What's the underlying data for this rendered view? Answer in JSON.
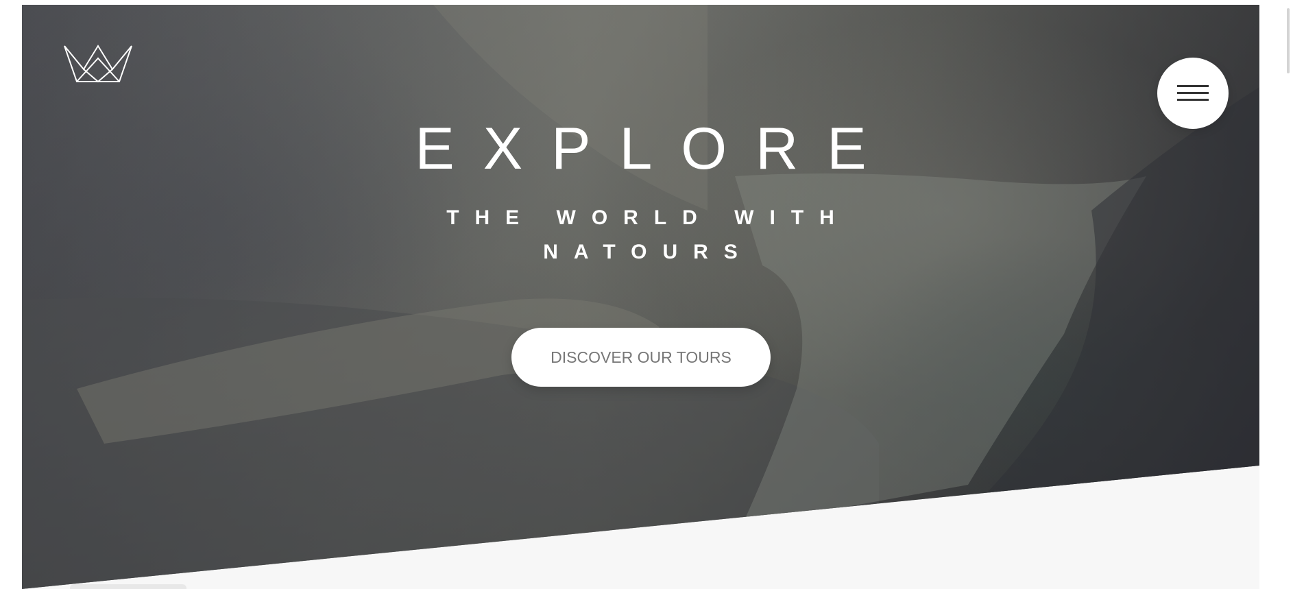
{
  "header": {
    "logo_icon": "crown-logo-icon",
    "menu_icon": "hamburger-menu-icon"
  },
  "hero": {
    "title_main": "EXPLORE",
    "title_sub": "THE WORLD WITH NATOURS",
    "cta_label": "DISCOVER OUR TOURS"
  },
  "colors": {
    "text_light": "#ffffff",
    "button_text": "#777777",
    "section_background": "#f7f7f7"
  }
}
